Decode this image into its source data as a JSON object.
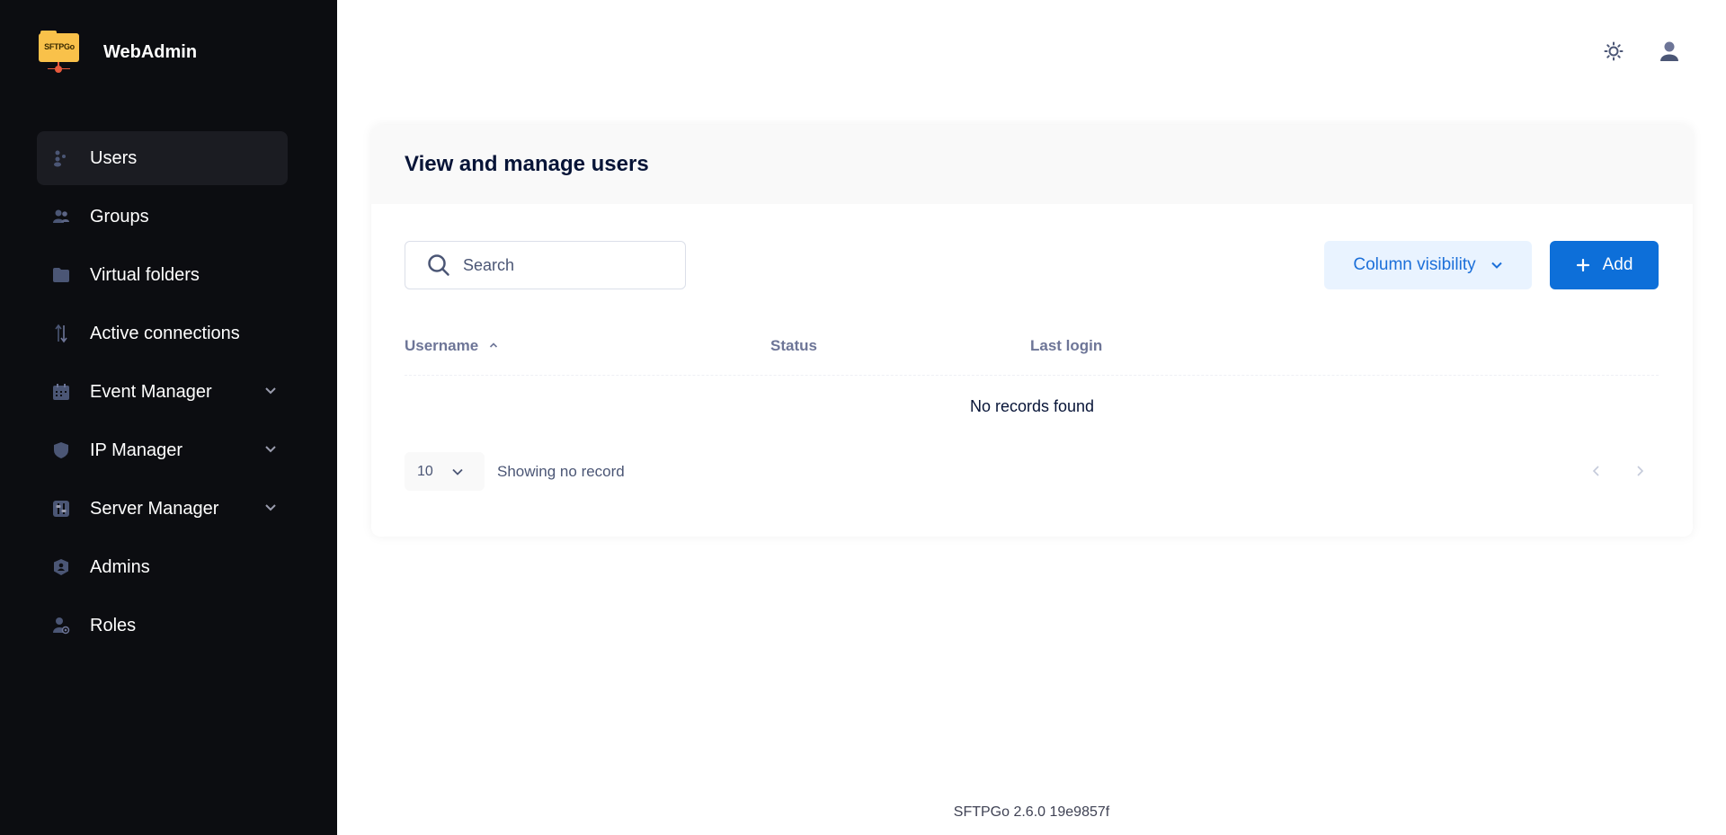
{
  "brand": {
    "name": "WebAdmin",
    "logo_text": "SFTPGo"
  },
  "sidebar": {
    "items": [
      {
        "label": "Users",
        "icon": "users-icon",
        "active": true,
        "expandable": false
      },
      {
        "label": "Groups",
        "icon": "groups-icon",
        "active": false,
        "expandable": false
      },
      {
        "label": "Virtual folders",
        "icon": "folder-icon",
        "active": false,
        "expandable": false
      },
      {
        "label": "Active connections",
        "icon": "arrows-updown-icon",
        "active": false,
        "expandable": false
      },
      {
        "label": "Event Manager",
        "icon": "calendar-icon",
        "active": false,
        "expandable": true
      },
      {
        "label": "IP Manager",
        "icon": "shield-icon",
        "active": false,
        "expandable": true
      },
      {
        "label": "Server Manager",
        "icon": "sliders-icon",
        "active": false,
        "expandable": true
      },
      {
        "label": "Admins",
        "icon": "admin-shield-icon",
        "active": false,
        "expandable": false
      },
      {
        "label": "Roles",
        "icon": "user-role-icon",
        "active": false,
        "expandable": false
      }
    ]
  },
  "header": {
    "theme_icon": "sun-icon",
    "user_icon": "user-icon"
  },
  "main": {
    "title": "View and manage users",
    "search": {
      "placeholder": "Search",
      "value": ""
    },
    "column_visibility_label": "Column visibility",
    "add_label": "Add",
    "table": {
      "columns": [
        "Username",
        "Status",
        "Last login"
      ],
      "sorted_column": "Username",
      "sort_direction": "ascending",
      "empty_message": "No records found"
    },
    "pagination": {
      "page_size": "10",
      "info": "Showing no record"
    }
  },
  "footer": {
    "version": "SFTPGo 2.6.0 19e9857f"
  },
  "colors": {
    "sidebar_bg": "#0c0d11",
    "primary": "#0d6fd9",
    "light_primary": "#e9f3ff",
    "logo": "#f9c14a"
  }
}
